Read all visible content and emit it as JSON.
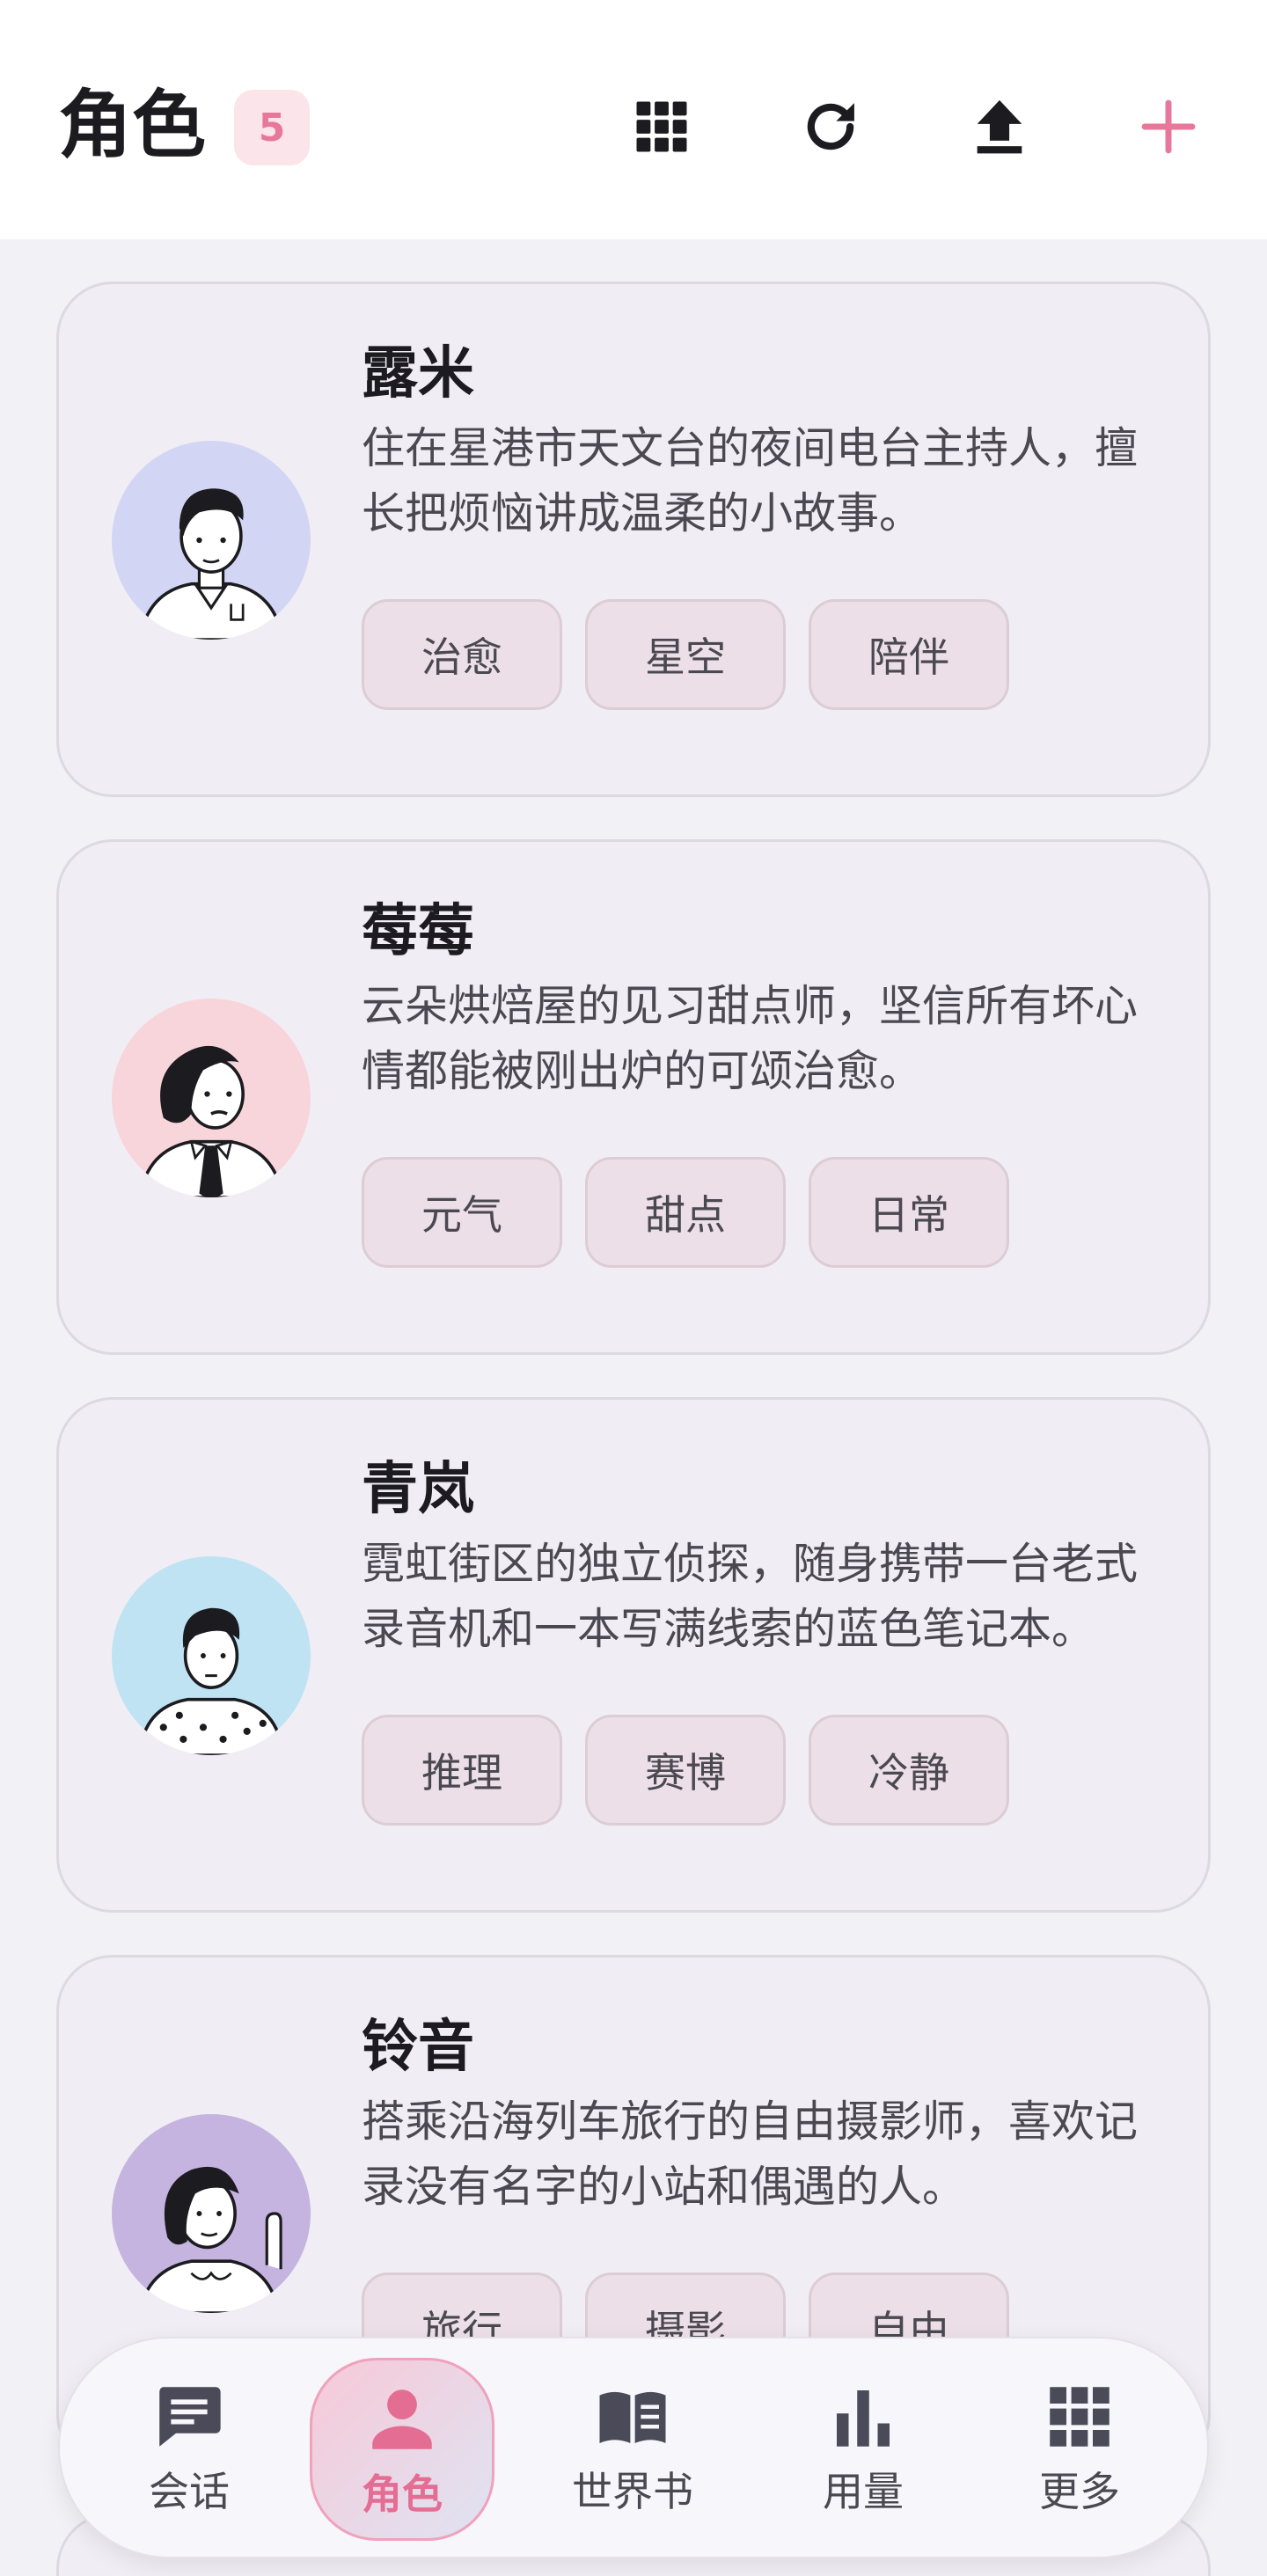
{
  "header": {
    "title": "角色",
    "count": "5",
    "icons": [
      "grid-icon",
      "refresh-icon",
      "upload-icon",
      "add-icon"
    ],
    "accent": "#e8789b"
  },
  "characters": [
    {
      "name": "露米",
      "description": "住在星港市天文台的夜间电台主持人，擅长把烦恼讲成温柔的小故事。",
      "tags": [
        "治愈",
        "星空",
        "陪伴"
      ],
      "avatar_bg": "#d3d5f5"
    },
    {
      "name": "莓莓",
      "description": "云朵烘焙屋的见习甜点师，坚信所有坏心情都能被刚出炉的可颂治愈。",
      "tags": [
        "元气",
        "甜点",
        "日常"
      ],
      "avatar_bg": "#f8d5db"
    },
    {
      "name": "青岚",
      "description": "霓虹街区的独立侦探，随身携带一台老式录音机和一本写满线索的蓝色笔记本。",
      "tags": [
        "推理",
        "赛博",
        "冷静"
      ],
      "avatar_bg": "#bfe3f2"
    },
    {
      "name": "铃音",
      "description": "搭乘沿海列车旅行的自由摄影师，喜欢记录没有名字的小站和偶遇的人。",
      "tags": [
        "旅行",
        "摄影",
        "自由"
      ],
      "avatar_bg": "#c5b4e0"
    }
  ],
  "nav": {
    "items": [
      {
        "label": "会话",
        "icon": "chat-icon"
      },
      {
        "label": "角色",
        "icon": "person-icon"
      },
      {
        "label": "世界书",
        "icon": "book-icon"
      },
      {
        "label": "用量",
        "icon": "bar-chart-icon"
      },
      {
        "label": "更多",
        "icon": "apps-grid-icon"
      }
    ],
    "active": "角色"
  }
}
